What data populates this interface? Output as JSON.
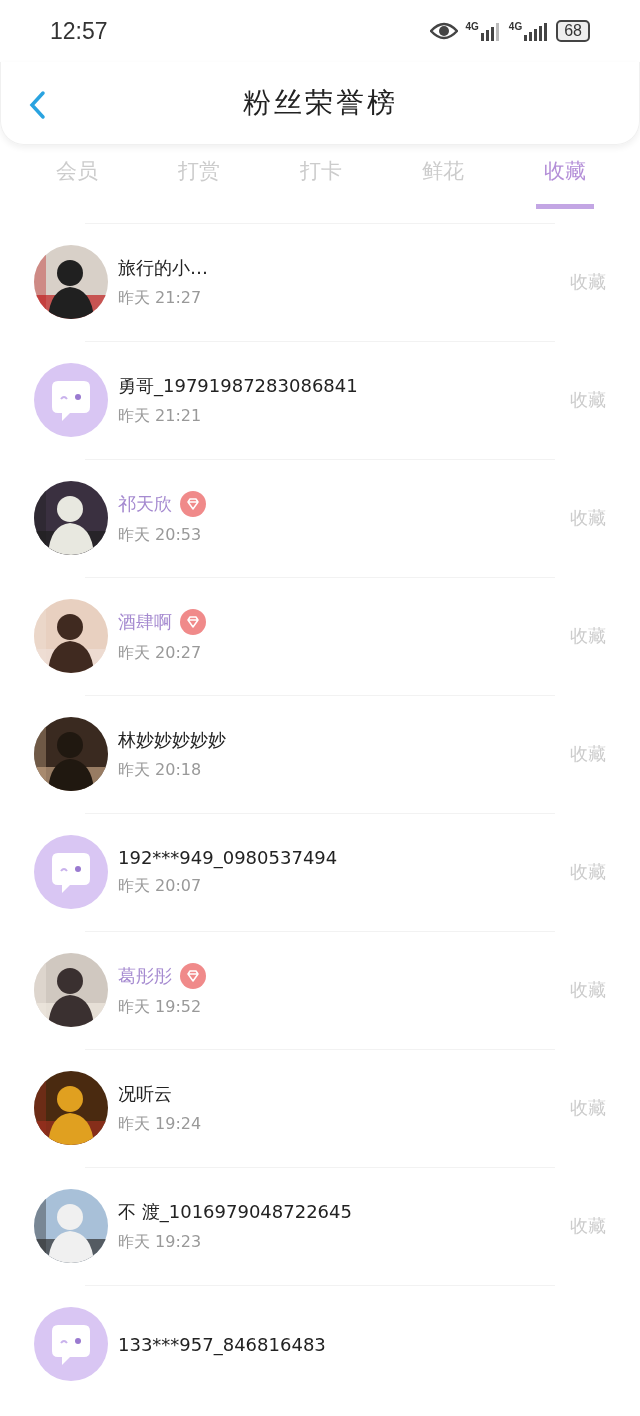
{
  "status_bar": {
    "time": "12:57",
    "battery": "68",
    "network_1": "4G",
    "network_2": "4G"
  },
  "header": {
    "title": "粉丝荣誉榜"
  },
  "tabs": [
    {
      "label": "会员",
      "selected": false
    },
    {
      "label": "打赏",
      "selected": false
    },
    {
      "label": "打卡",
      "selected": false
    },
    {
      "label": "鲜花",
      "selected": false
    },
    {
      "label": "收藏",
      "selected": true
    }
  ],
  "fans": [
    {
      "name": "旅行的小…",
      "vip": false,
      "time": "昨天 21:27",
      "action": "收藏"
    },
    {
      "avatar": {
        "kind": "default"
      },
      "name": "勇哥_19791987283086841",
      "vip": false,
      "time": "昨天 21:21",
      "action": "收藏"
    },
    {
      "name": "祁天欣",
      "vip": true,
      "time": "昨天 20:53",
      "action": "收藏"
    },
    {
      "name": "酒肆啊",
      "vip": true,
      "time": "昨天 20:27",
      "action": "收藏"
    },
    {
      "name": "林妙妙妙妙妙",
      "vip": false,
      "time": "昨天 20:18",
      "action": "收藏"
    },
    {
      "avatar": {
        "kind": "default"
      },
      "name": "192***949_0980537494",
      "vip": false,
      "time": "昨天 20:07",
      "action": "收藏"
    },
    {
      "name": "葛彤彤",
      "vip": true,
      "time": "昨天 19:52",
      "action": "收藏"
    },
    {
      "name": "况听云",
      "vip": false,
      "time": "昨天 19:24",
      "action": "收藏"
    },
    {
      "name": "不 渡_1016979048722645",
      "vip": false,
      "time": "昨天 19:23",
      "action": "收藏"
    },
    {
      "avatar": {
        "kind": "default"
      },
      "name": "133***957_846816483",
      "vip": false
    }
  ]
}
